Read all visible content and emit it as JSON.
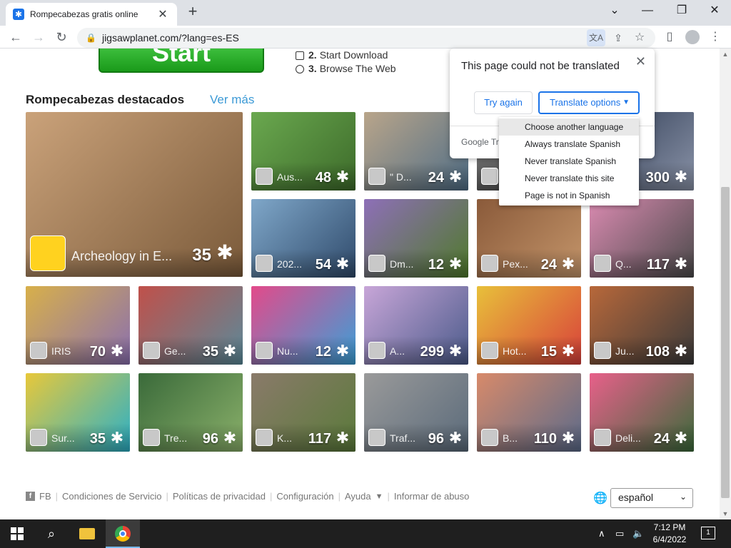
{
  "browser": {
    "tab_title": "Rompecabezas gratis online",
    "tab_close": "✕",
    "new_tab": "+",
    "win_minimize": "⌄",
    "win_restore": "❐",
    "win_close": "✕",
    "url": "jigsawplanet.com/?lang=es-ES"
  },
  "page": {
    "start_label": "Start",
    "steps": [
      {
        "num": "2.",
        "text": "Start Download"
      },
      {
        "num": "3.",
        "text": "Browse The Web"
      }
    ],
    "section_title": "Rompecabezas destacados",
    "see_more": "Ver más",
    "puzzles": [
      {
        "name": "Archeology in E...",
        "count": "35",
        "colors": [
          "#caa27a",
          "#7a5a3a"
        ]
      },
      {
        "name": "Aus...",
        "count": "48",
        "colors": [
          "#6aa84f",
          "#3d6b2a"
        ]
      },
      {
        "name": "\" D...",
        "count": "24",
        "colors": [
          "#b9a58a",
          "#4f6d86"
        ]
      },
      {
        "name": "",
        "count": "",
        "colors": [
          "#777777",
          "#444444"
        ]
      },
      {
        "name": "",
        "count": "300",
        "colors": [
          "#2d3a52",
          "#8a93a8"
        ]
      },
      {
        "name": "202...",
        "count": "54",
        "colors": [
          "#7fa7c9",
          "#2f4a6b"
        ]
      },
      {
        "name": "Dm...",
        "count": "12",
        "colors": [
          "#8e6fb8",
          "#4f7a2a"
        ]
      },
      {
        "name": "Pex...",
        "count": "24",
        "colors": [
          "#8a5a3a",
          "#c4956a"
        ]
      },
      {
        "name": "Q...",
        "count": "117",
        "colors": [
          "#d98ab0",
          "#4a4a4a"
        ]
      },
      {
        "name": "IRIS",
        "count": "70",
        "colors": [
          "#d8b04a",
          "#8a6fb0"
        ]
      },
      {
        "name": "Ge...",
        "count": "35",
        "colors": [
          "#c0504a",
          "#5a8a9a"
        ]
      },
      {
        "name": "Nu...",
        "count": "12",
        "colors": [
          "#e34a8a",
          "#3aa0d8"
        ]
      },
      {
        "name": "A...",
        "count": "299",
        "colors": [
          "#c8a6d8",
          "#4a5a8a"
        ]
      },
      {
        "name": "Hot...",
        "count": "15",
        "colors": [
          "#e8c03a",
          "#d8403a"
        ]
      },
      {
        "name": "Ju...",
        "count": "108",
        "colors": [
          "#b8683a",
          "#3a3a3a"
        ]
      },
      {
        "name": "Sur...",
        "count": "35",
        "colors": [
          "#e8c83a",
          "#2ab0c8"
        ]
      },
      {
        "name": "Tre...",
        "count": "96",
        "colors": [
          "#3a6a3a",
          "#8ab06a"
        ]
      },
      {
        "name": "K...",
        "count": "117",
        "colors": [
          "#8a7a6a",
          "#5a7a3a"
        ]
      },
      {
        "name": "Traf...",
        "count": "96",
        "colors": [
          "#9a9a9a",
          "#5a6a7a"
        ]
      },
      {
        "name": "B...",
        "count": "110",
        "colors": [
          "#d88a6a",
          "#5a6a8a"
        ]
      },
      {
        "name": "Deli...",
        "count": "24",
        "colors": [
          "#e8608a",
          "#3a6a3a"
        ]
      }
    ],
    "footer": [
      "FB",
      "Condiciones de Servicio",
      "Políticas de privacidad",
      "Configuración",
      "Ayuda",
      "Informar de abuso"
    ],
    "footer_caret": "▼",
    "language_selected": "español"
  },
  "translate": {
    "message": "This page could not be translated",
    "try_again": "Try again",
    "translate_options": "Translate options",
    "google": "Google Tr",
    "menu": [
      "Choose another language",
      "Always translate Spanish",
      "Never translate Spanish",
      "Never translate this site",
      "Page is not in Spanish"
    ]
  },
  "taskbar": {
    "time": "7:12 PM",
    "date": "6/4/2022",
    "notification_count": "1"
  }
}
